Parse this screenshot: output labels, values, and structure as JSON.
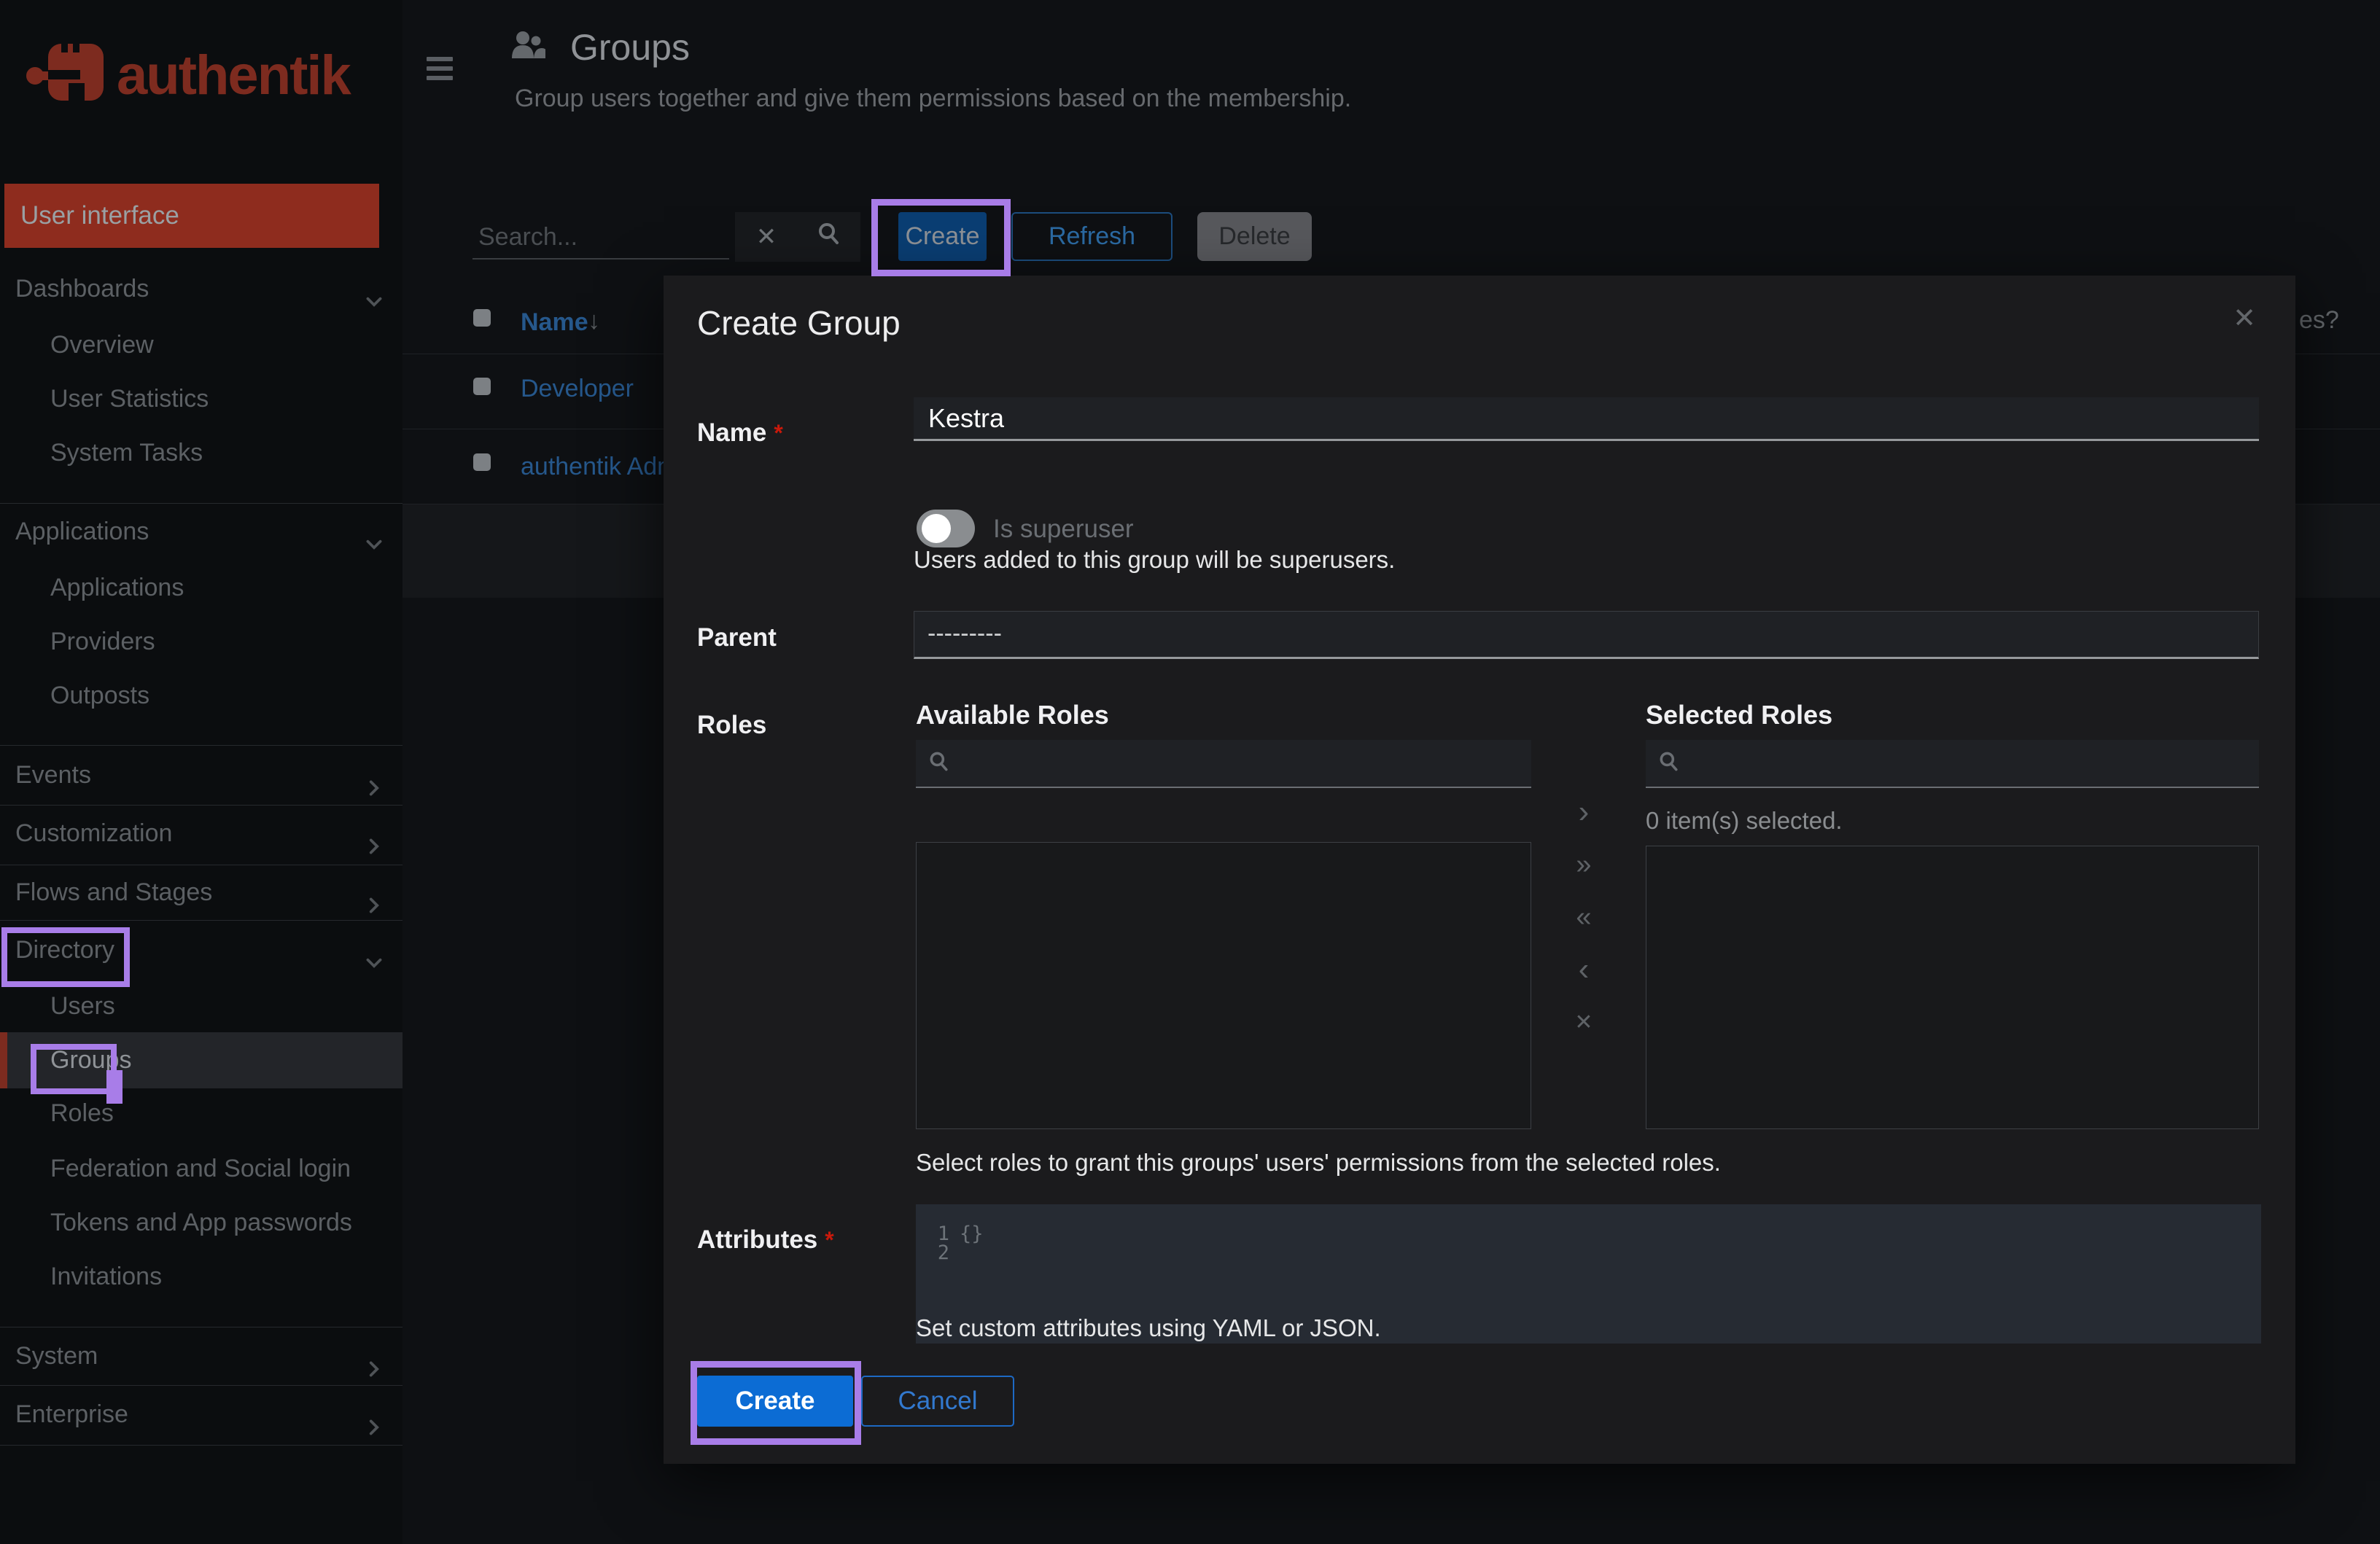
{
  "app": {
    "name": "authentik"
  },
  "sidebar": {
    "user_interface": "User interface",
    "dashboards": "Dashboards",
    "overview": "Overview",
    "user_statistics": "User Statistics",
    "system_tasks": "System Tasks",
    "applications_group": "Applications",
    "applications": "Applications",
    "providers": "Providers",
    "outposts": "Outposts",
    "events": "Events",
    "customization": "Customization",
    "flows_and_stages": "Flows and Stages",
    "directory": "Directory",
    "users": "Users",
    "groups": "Groups",
    "roles": "Roles",
    "federation": "Federation and Social login",
    "tokens": "Tokens and App passwords",
    "invitations": "Invitations",
    "system": "System",
    "enterprise": "Enterprise"
  },
  "header": {
    "title": "Groups",
    "subtitle": "Group users together and give them permissions based on the membership."
  },
  "toolbar": {
    "search_placeholder": "Search...",
    "create": "Create",
    "refresh": "Refresh",
    "delete": "Delete"
  },
  "table": {
    "name_column": "Name",
    "rows": [
      {
        "name": "Developer"
      },
      {
        "name": "authentik Admin"
      }
    ],
    "clipped_column_fragment": "es?"
  },
  "modal": {
    "title": "Create Group",
    "required_marker": "*",
    "name_label": "Name",
    "name_value": "Kestra",
    "is_superuser_label": "Is superuser",
    "is_superuser_help": "Users added to this group will be superusers.",
    "parent_label": "Parent",
    "parent_value": "---------",
    "roles_label": "Roles",
    "available_roles": "Available Roles",
    "selected_roles": "Selected Roles",
    "selected_count": "0 item(s) selected.",
    "roles_help": "Select roles to grant this groups' users' permissions from the selected roles.",
    "attributes_label": "Attributes",
    "attributes_line_numbers": [
      "1",
      "2"
    ],
    "attributes_value": "{}",
    "attributes_help": "Set custom attributes using YAML or JSON.",
    "create": "Create",
    "cancel": "Cancel"
  },
  "icons": {
    "close": "✕",
    "clear_search": "✕",
    "sort_descending": "↓",
    "transfer_add": "›",
    "transfer_add_all": "»",
    "transfer_remove_all": "«",
    "transfer_remove": "‹",
    "transfer_clear": "✕"
  },
  "colors": {
    "brand_red": "#7d2b1f",
    "primary_blue": "#0c6cd4",
    "link_blue": "#26588c",
    "annotation_purple": "#a87de8"
  }
}
